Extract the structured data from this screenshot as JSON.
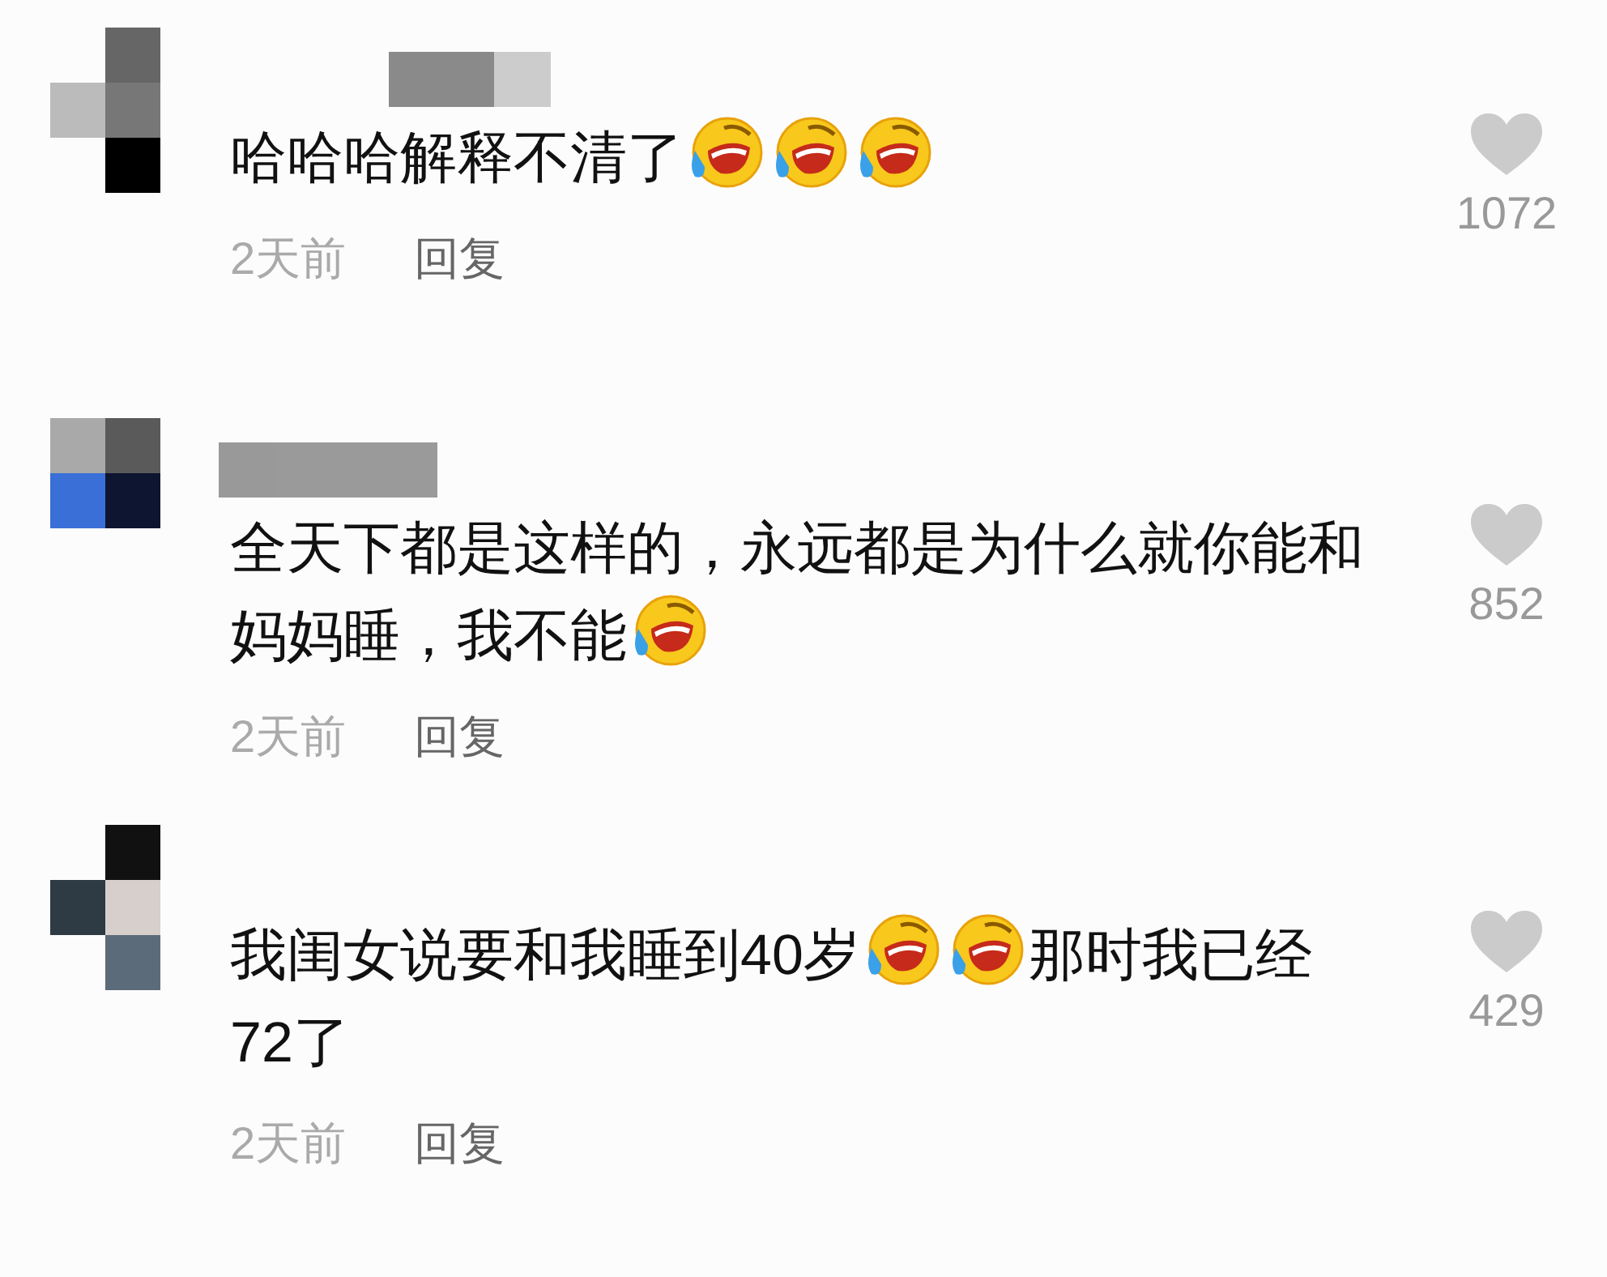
{
  "comments": [
    {
      "content": [
        {
          "kind": "text",
          "text": "哈哈哈解释不清了"
        },
        {
          "kind": "emoji"
        },
        {
          "kind": "emoji"
        },
        {
          "kind": "emoji"
        }
      ],
      "time": "2天前",
      "reply": "回复",
      "likes": "1072"
    },
    {
      "content": [
        {
          "kind": "text",
          "text": "全天下都是这样的，永远都是为什么就你能和妈妈睡，我不能"
        },
        {
          "kind": "emoji"
        }
      ],
      "time": "2天前",
      "reply": "回复",
      "likes": "852"
    },
    {
      "content": [
        {
          "kind": "text",
          "text": "我闺女说要和我睡到40岁"
        },
        {
          "kind": "emoji"
        },
        {
          "kind": "emoji"
        },
        {
          "kind": "text",
          "text": "那时我已经72了"
        }
      ],
      "time": "2天前",
      "reply": "回复",
      "likes": "429"
    }
  ]
}
